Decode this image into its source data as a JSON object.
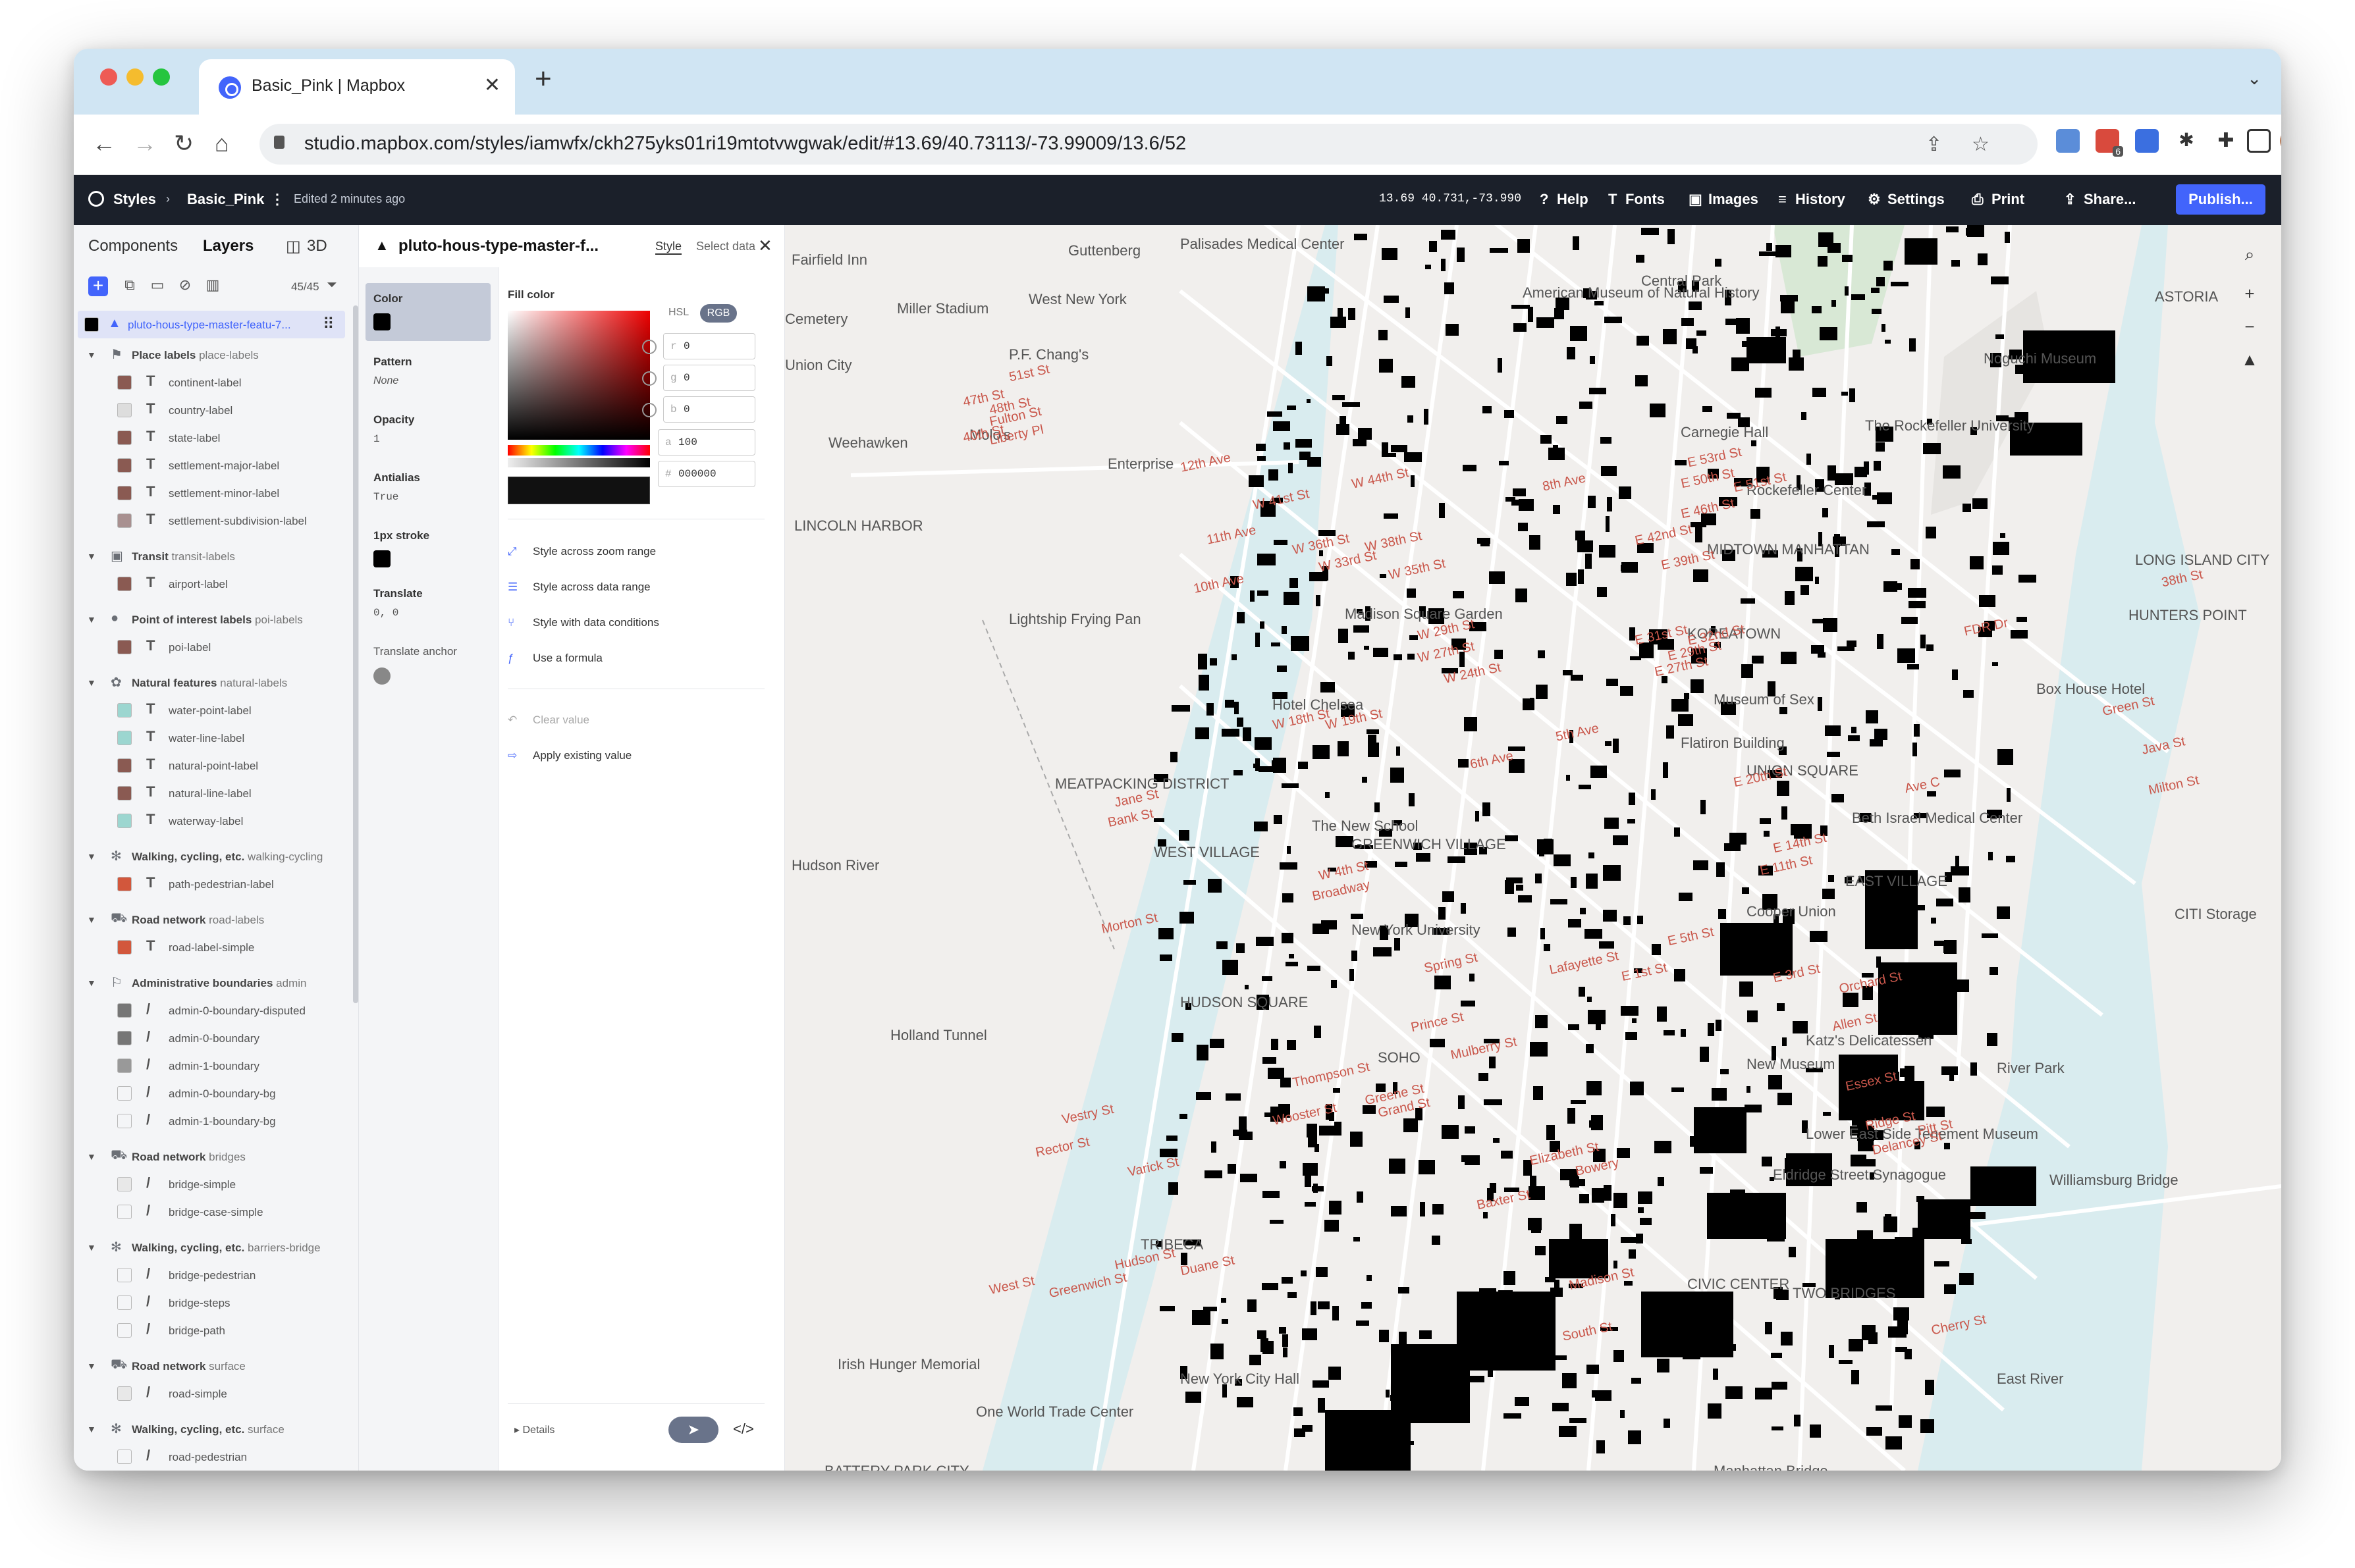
{
  "browser": {
    "tab_title": "Basic_Pink | Mapbox",
    "tab_close": "✕",
    "new_tab": "+",
    "url": "studio.mapbox.com/styles/iamwfx/ckh275yks01ri19mtotvwgwak/edit/#13.69/40.73113/-73.99009/13.6/52",
    "back": "←",
    "forward": "→",
    "reload": "↻",
    "home": "⌂",
    "share": "⇪",
    "star": "☆",
    "ext_badge": "6"
  },
  "appbar": {
    "styles": "Styles",
    "sep": "›",
    "style_name": "Basic_Pink",
    "menu": "⋮",
    "edited": "Edited 2 minutes ago",
    "coords": "13.69 40.731,-73.990",
    "help": "Help",
    "fonts": "Fonts",
    "images": "Images",
    "history": "History",
    "settings": "Settings",
    "print": "Print",
    "share": "Share...",
    "publish": "Publish..."
  },
  "left_panel": {
    "tabs": {
      "components": "Components",
      "layers": "Layers",
      "three_d": "3D"
    },
    "count": "45/45",
    "selected_layer": "pluto-hous-type-master-featu-7...",
    "groups": [
      {
        "icon": "⚑",
        "name": "Place labels",
        "id": "place-labels",
        "layers": [
          {
            "name": "continent-label",
            "color": "#8a5a52",
            "type": "T"
          },
          {
            "name": "country-label",
            "color": "#ddd",
            "type": "T"
          },
          {
            "name": "state-label",
            "color": "#8a5a52",
            "type": "T"
          },
          {
            "name": "settlement-major-label",
            "color": "#8a5a52",
            "type": "T"
          },
          {
            "name": "settlement-minor-label",
            "color": "#8a5a52",
            "type": "T"
          },
          {
            "name": "settlement-subdivision-label",
            "color": "#a89090",
            "type": "T"
          }
        ]
      },
      {
        "icon": "▣",
        "name": "Transit",
        "id": "transit-labels",
        "layers": [
          {
            "name": "airport-label",
            "color": "#8a5a52",
            "type": "T"
          }
        ]
      },
      {
        "icon": "●",
        "name": "Point of interest labels",
        "id": "poi-labels",
        "layers": [
          {
            "name": "poi-label",
            "color": "#8a5a52",
            "type": "T"
          }
        ]
      },
      {
        "icon": "✿",
        "name": "Natural features",
        "id": "natural-labels",
        "layers": [
          {
            "name": "water-point-label",
            "color": "#9cd6d0",
            "type": "T"
          },
          {
            "name": "water-line-label",
            "color": "#9cd6d0",
            "type": "T"
          },
          {
            "name": "natural-point-label",
            "color": "#8a5a52",
            "type": "T"
          },
          {
            "name": "natural-line-label",
            "color": "#8a5a52",
            "type": "T"
          },
          {
            "name": "waterway-label",
            "color": "#9cd6d0",
            "type": "T"
          }
        ]
      },
      {
        "icon": "✻",
        "name": "Walking, cycling, etc.",
        "id": "walking-cycling",
        "layers": [
          {
            "name": "path-pedestrian-label",
            "color": "#d2573c",
            "type": "T"
          }
        ]
      },
      {
        "icon": "⛟",
        "name": "Road network",
        "id": "road-labels",
        "layers": [
          {
            "name": "road-label-simple",
            "color": "#d2573c",
            "type": "T"
          }
        ]
      },
      {
        "icon": "⚐",
        "name": "Administrative boundaries",
        "id": "admin",
        "layers": [
          {
            "name": "admin-0-boundary-disputed",
            "color": "#767676",
            "type": "/"
          },
          {
            "name": "admin-0-boundary",
            "color": "#767676",
            "type": "/"
          },
          {
            "name": "admin-1-boundary",
            "color": "#999",
            "type": "/"
          },
          {
            "name": "admin-0-boundary-bg",
            "color": "#f4f5f7",
            "type": "/"
          },
          {
            "name": "admin-1-boundary-bg",
            "color": "#f4f5f7",
            "type": "/"
          }
        ]
      },
      {
        "icon": "⛟",
        "name": "Road network",
        "id": "bridges",
        "layers": [
          {
            "name": "bridge-simple",
            "color": "#e8e8e8",
            "type": "/"
          },
          {
            "name": "bridge-case-simple",
            "color": "#f4f5f7",
            "type": "/"
          }
        ]
      },
      {
        "icon": "✻",
        "name": "Walking, cycling, etc.",
        "id": "barriers-bridge",
        "layers": [
          {
            "name": "bridge-pedestrian",
            "color": "#f4f5f7",
            "type": "/"
          },
          {
            "name": "bridge-steps",
            "color": "#f4f5f7",
            "type": "/"
          },
          {
            "name": "bridge-path",
            "color": "#f4f5f7",
            "type": "/"
          }
        ]
      },
      {
        "icon": "⛟",
        "name": "Road network",
        "id": "surface",
        "layers": [
          {
            "name": "road-simple",
            "color": "#e8e8e8",
            "type": "/"
          }
        ]
      },
      {
        "icon": "✻",
        "name": "Walking, cycling, etc.",
        "id": "surface",
        "layers": [
          {
            "name": "road-pedestrian",
            "color": "#f4f5f7",
            "type": "/"
          },
          {
            "name": "road-steps",
            "color": "#f4f5f7",
            "type": "/"
          }
        ]
      }
    ]
  },
  "prop_panel": {
    "title": "pluto-hous-type-master-f...",
    "tab_style": "Style",
    "tab_select": "Select data",
    "close": "✕",
    "props": {
      "color": "Color",
      "pattern": "Pattern",
      "pattern_val": "None",
      "opacity": "Opacity",
      "opacity_val": "1",
      "antialias": "Antialias",
      "antialias_val": "True",
      "stroke": "1px stroke",
      "translate": "Translate",
      "translate_val": "0, 0",
      "anchor": "Translate anchor"
    },
    "fill_color": "Fill color",
    "mode_hsl": "HSL",
    "mode_rgb": "RGB",
    "r_label": "r",
    "r": "0",
    "g_label": "g",
    "g": "0",
    "b_label": "b",
    "b": "0",
    "a_label": "a",
    "alpha": "100",
    "hex_label": "#",
    "hex": "000000",
    "actions": {
      "zoom": "Style across zoom range",
      "data": "Style across data range",
      "cond": "Style with data conditions",
      "formula": "Use a formula",
      "clear": "Clear value",
      "apply": "Apply existing value"
    },
    "details": "Details"
  },
  "map": {
    "labels": [
      "Union City",
      "Weehawken",
      "West New York",
      "Guttenberg",
      "Miller Stadium",
      "P.F. Chang's",
      "Molo's",
      "Enterprise",
      "LINCOLN HARBOR",
      "Lightship Frying Pan",
      "MEATPACKING DISTRICT",
      "Hudson River",
      "Palisades Medical Center",
      "Central Park",
      "Carnegie Hall",
      "Rockefeller Center",
      "MIDTOWN MANHATTAN",
      "Madison Square Garden",
      "KOREATOWN",
      "Museum of Sex",
      "Flatiron Building",
      "Hotel Chelsea",
      "UNION SQUARE",
      "The New School",
      "GREENWICH VILLAGE",
      "WEST VILLAGE",
      "New York University",
      "EAST VILLAGE",
      "Cooper Union",
      "Beth Israel Medical Center",
      "HUDSON SQUARE",
      "SOHO",
      "New Museum",
      "Katz's Delicatessen",
      "Holland Tunnel",
      "Lower East Side Tenement Museum",
      "Eldridge Street Synagogue",
      "TRIBECA",
      "CIVIC CENTER",
      "TWO BRIDGES",
      "Irish Hunger Memorial",
      "New York City Hall",
      "One World Trade Center",
      "BATTERY PARK CITY",
      "Manhattan Bridge",
      "Williamsburg Bridge",
      "River Park",
      "CITI Storage",
      "East River",
      "LONG ISLAND CITY",
      "HUNTERS POINT",
      "Box House Hotel",
      "Noguchi Museum",
      "The Rockefeller University",
      "ASTORIA",
      "American Museum of Natural History",
      "Fairfield Inn",
      "Cemetery"
    ],
    "streets": [
      "W 41st St",
      "W 44th St",
      "W 38th St",
      "W 35th St",
      "W 36th St",
      "W 33rd St",
      "W 29th St",
      "W 27th St",
      "W 24th St",
      "W 18th St",
      "W 19th St",
      "W 4th St",
      "E 53rd St",
      "E 50th St",
      "E 51st St",
      "E 46th St",
      "E 42nd St",
      "E 39th St",
      "E 31st St",
      "E 32nd St",
      "E 29th St",
      "E 27th St",
      "E 20th St",
      "E 14th St",
      "E 11th St",
      "E 5th St",
      "E 1st St",
      "E 3rd St",
      "11th Ave",
      "10th Ave",
      "12th Ave",
      "8th Ave",
      "6th Ave",
      "5th Ave",
      "Ave C",
      "FDR Dr",
      "Morton St",
      "Prince St",
      "Grand St",
      "Delancey St",
      "Madison St",
      "South St",
      "Duane St",
      "West St",
      "Greenwich St",
      "Hudson St",
      "Varick St",
      "Thompson St",
      "Wooster St",
      "Greene St",
      "Mulberry St",
      "Elizabeth St",
      "Bowery",
      "Baxter St",
      "Bank St",
      "Jane St",
      "Ridge St",
      "Pitt St",
      "Cherry St",
      "Rector St",
      "Green St",
      "Java St",
      "Milton St",
      "Liberty Pl",
      "Fulton St",
      "47th St",
      "51st St",
      "48th St",
      "40th St",
      "38th St",
      "Vestry St",
      "Essex St",
      "Allen St",
      "Orchard St",
      "Broadway",
      "Lafayette St",
      "Spring St"
    ]
  },
  "colors": {
    "accent": "#4264fb",
    "appbar": "#1b202a",
    "water": "#d9ecef",
    "land": "#f1efed",
    "street_label": "#c9574b",
    "building": "#000000"
  }
}
